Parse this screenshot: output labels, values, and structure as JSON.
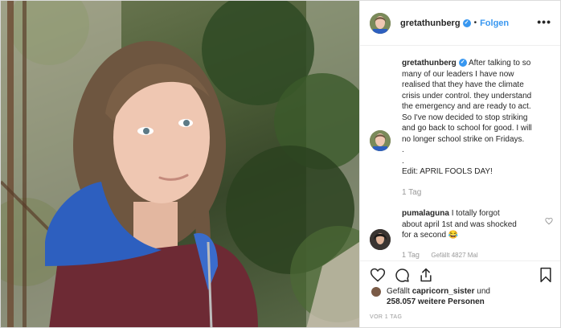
{
  "header": {
    "username": "gretathunberg",
    "verified_badge": "✓",
    "separator": "•",
    "follow_label": "Folgen",
    "more_label": "•••"
  },
  "caption": {
    "username": "gretathunberg",
    "lines": [
      "After talking to so",
      "many of our leaders I have now",
      "realised that they have the climate",
      "crisis under control. they understand",
      "the emergency and are ready to act.",
      "So I've now decided to stop striking",
      "and go back to school for good. I will",
      "no longer school strike on Fridays.",
      ".",
      ".",
      "Edit: APRIL FOOLS DAY!"
    ],
    "time": "1 Tag"
  },
  "comment": {
    "username": "pumalaguna",
    "lines": [
      "I totally forgot",
      "about april 1st and was shocked",
      "for a second 😂"
    ],
    "time": "1 Tag",
    "likes": "Gefällt 4827 Mal"
  },
  "likes": {
    "line1_prefix": "Gefällt ",
    "line1_user": "capricorn_sister",
    "line1_suffix": " und",
    "line2_count": "258.057",
    "line2_suffix": " weitere Personen"
  },
  "posted": "VOR 1 TAG",
  "icons": {
    "like": "heart-icon",
    "comment": "comment-icon",
    "share": "share-icon",
    "save": "bookmark-icon",
    "comment_like": "heart-icon"
  },
  "colors": {
    "accent": "#3897f0",
    "secondary_text": "#999999",
    "border": "#efefef"
  }
}
